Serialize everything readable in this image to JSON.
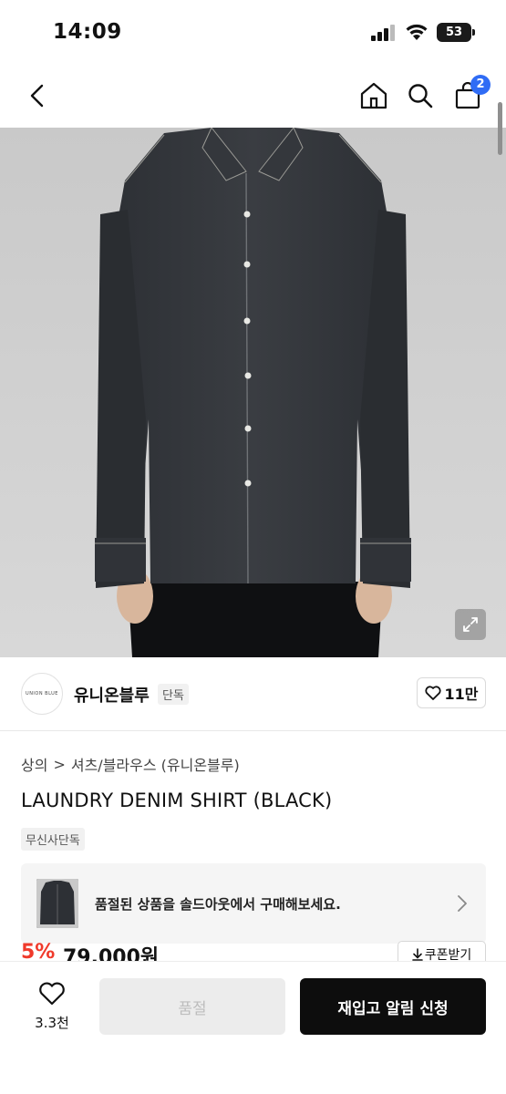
{
  "status_bar": {
    "time": "14:09",
    "battery": "53"
  },
  "nav": {
    "cart_count": "2"
  },
  "brand": {
    "logo_text": "UNION BLUE",
    "name": "유니온블루",
    "tag": "단독",
    "likes": "11만"
  },
  "breadcrumb": {
    "category": "상의",
    "separator": ">",
    "subcategory": "셔츠/블라우스 (유니온블루)"
  },
  "product": {
    "title": "LAUNDRY DENIM SHIRT (BLACK)",
    "exclusive_tag": "무신사단독",
    "discount": "5%",
    "price": "79,000원",
    "coupon_label": "쿠폰받기"
  },
  "soldout_banner": {
    "text": "품절된 상품을 솔드아웃에서 구매해보세요."
  },
  "bottom_bar": {
    "wish_count": "3.3천",
    "soldout_label": "품절",
    "restock_label": "재입고 알림 신청"
  },
  "colors": {
    "accent_blue": "#2f6cf5",
    "discount_red": "#f03a2b",
    "primary_black": "#0d0d0d"
  }
}
